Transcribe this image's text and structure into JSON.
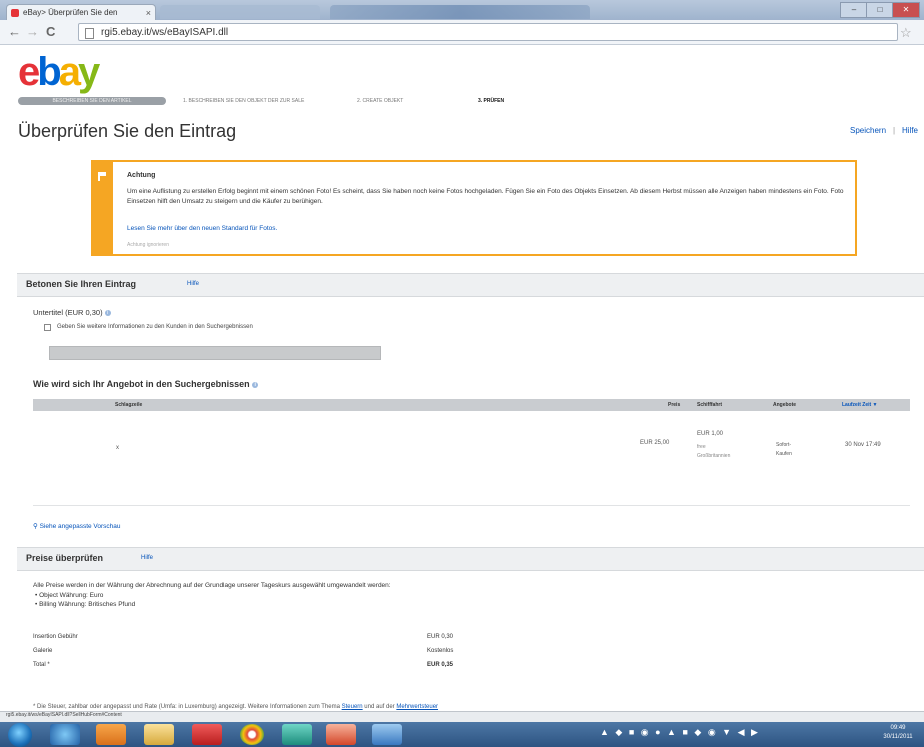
{
  "browser": {
    "tab_title": "eBay> Überprüfen Sie den",
    "tab_close": "×",
    "url": "rgi5.ebay.it/ws/eBayISAPI.dll",
    "nav_back": "←",
    "nav_forward": "→",
    "nav_reload": "C",
    "star": "☆",
    "win_min": "–",
    "win_max": "□",
    "win_close": "✕"
  },
  "logo": {
    "e": "e",
    "b": "b",
    "a": "a",
    "y": "y"
  },
  "steps": [
    {
      "label": "BESCHREIBEN SIE DEN ARTIKEL"
    },
    {
      "label": "1. BESCHREIBEN SIE DEN OBJEKT DER ZUR SALE"
    },
    {
      "label": "2. CREATE OBJEKT"
    },
    {
      "label": "3. PRÜFEN"
    }
  ],
  "page": {
    "title": "Überprüfen Sie den Eintrag",
    "link_save": "Speichern",
    "link_help": "Hilfe"
  },
  "alert": {
    "title": "Achtung",
    "message": "Um eine Auflistung zu erstellen Erfolg beginnt mit einem schönen Foto! Es scheint, dass Sie haben noch keine Fotos hochgeladen. Fügen Sie ein Foto des Objekts Einsetzen. Ab diesem Herbst müssen alle Anzeigen haben mindestens ein Foto. Foto Einsetzen hilft den Umsatz zu steigern und die Käufer zu berühigen.",
    "link": "Lesen Sie mehr über den neuen Standard für Fotos.",
    "faint": "Achtung ignorieren"
  },
  "emphasize": {
    "title": "Betonen Sie Ihren Eintrag",
    "help": "Hilfe",
    "subtitle_label": "Untertitel (EUR 0,30)",
    "checkbox_label": "Geben Sie weitere Informationen zu den Kunden in den Suchergebnissen"
  },
  "search_results": {
    "title": "Wie wird sich Ihr Angebot in den Suchergebnissen",
    "columns": {
      "title": "Schlagzeile",
      "price": "Preis",
      "shipping": "Schifffahrt",
      "format": "Angebote",
      "time": "Laufzeit Zeit ▼"
    },
    "row": {
      "title": "x",
      "price": "EUR 25,00",
      "shipping": "EUR 1,00",
      "shipping_sub1": "free",
      "shipping_sub2": "Großbritannien",
      "format1": "Sofort-",
      "format2": "Kaufen",
      "time": "30 Nov 17:49"
    },
    "preview_link": "Siehe angepasste Vorschau"
  },
  "prices": {
    "title": "Preise überprüfen",
    "help": "Hilfe",
    "intro": "Alle Preise werden in der Währung der Abrechnung auf der Grundlage unserer Tageskurs ausgewählt umgewandelt werden:",
    "bullets": [
      "Object Währung: Euro",
      "Billing Währung: Britisches Pfund"
    ],
    "rows": [
      {
        "label": "Insertion Gebühr",
        "value": "EUR 0,30"
      },
      {
        "label": "Galerie",
        "value": "Kostenlos"
      },
      {
        "label": "Total *",
        "value": "EUR 0,35"
      }
    ],
    "footnote_prefix": "* Die Steuer, zahlbar oder angepasst und Rate (Umfa: in Luxemburg) angezeigt. Weitere Informationen zum Thema ",
    "footnote_link1": "Steuern",
    "footnote_mid": " und auf der ",
    "footnote_link2": "Mehrwertsteuer"
  },
  "statusbar": {
    "url": "rgi5.ebay.it/ws/eBayISAPI.dll?SellHubForm#Content"
  },
  "taskbar": {
    "tray": "▲ ◆ ■ ◉ ● ▲ ■ ◆ ◉ ▼ ◀ ▶",
    "time": "09:49",
    "date": "30/11/2011"
  }
}
